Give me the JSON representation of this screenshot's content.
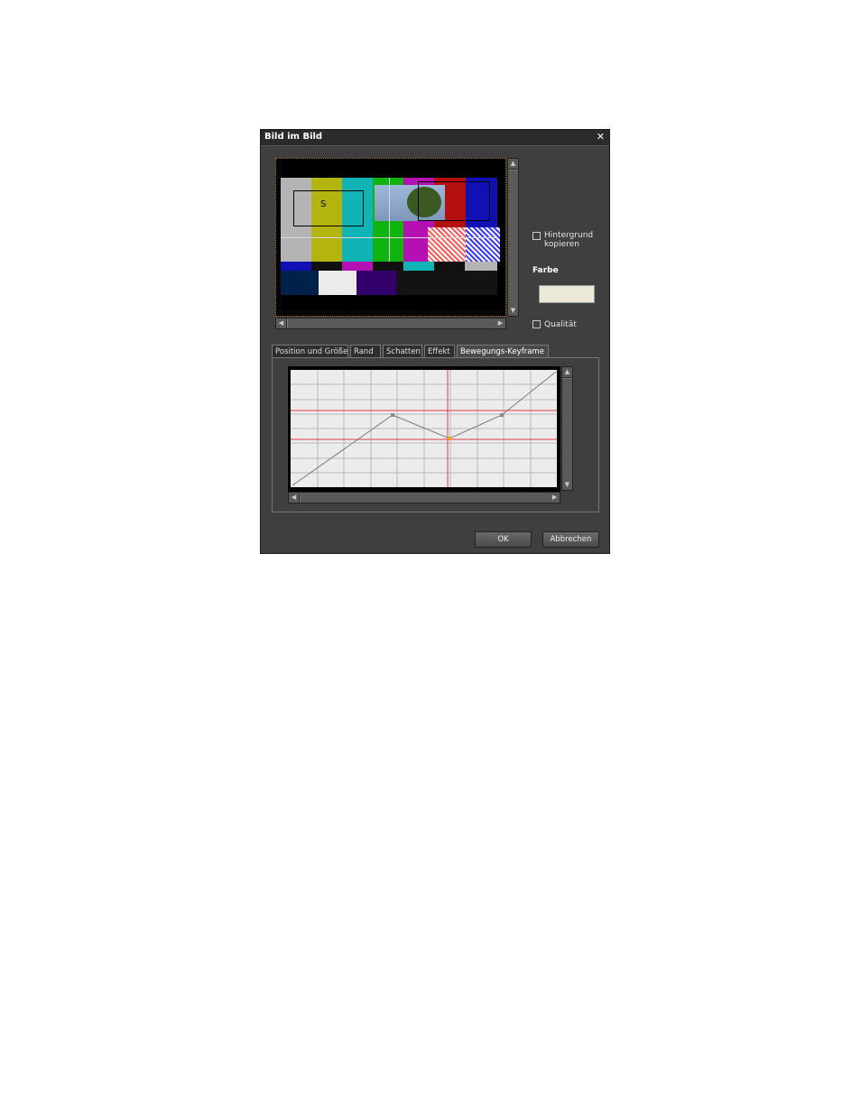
{
  "dialog": {
    "title": "Bild im Bild",
    "close_glyph": "✕"
  },
  "options": {
    "hintergrund_line1": "Hintergrund",
    "hintergrund_line2": "kopieren",
    "farbe_label": "Farbe",
    "farbe_color": "#ece9d8",
    "qualitaet_label": "Qualität",
    "preview_letter": "S"
  },
  "tabs": [
    {
      "label": "Position und Größe",
      "active": false
    },
    {
      "label": "Rand",
      "active": false
    },
    {
      "label": "Schatten",
      "active": false
    },
    {
      "label": "Effekt",
      "active": false
    },
    {
      "label": "Bewegungs-Keyframe",
      "active": true
    }
  ],
  "buttons": {
    "ok": "OK",
    "cancel": "Abbrechen"
  },
  "scroll_glyphs": {
    "up": "▲",
    "down": "▼",
    "left": "◀",
    "right": "▶",
    "grip": "≡",
    "hgrip": "|||"
  },
  "icons": {
    "close": "close-icon",
    "scroll_up": "arrow-up-icon",
    "scroll_down": "arrow-down-icon",
    "scroll_left": "arrow-left-icon",
    "scroll_right": "arrow-right-icon"
  }
}
